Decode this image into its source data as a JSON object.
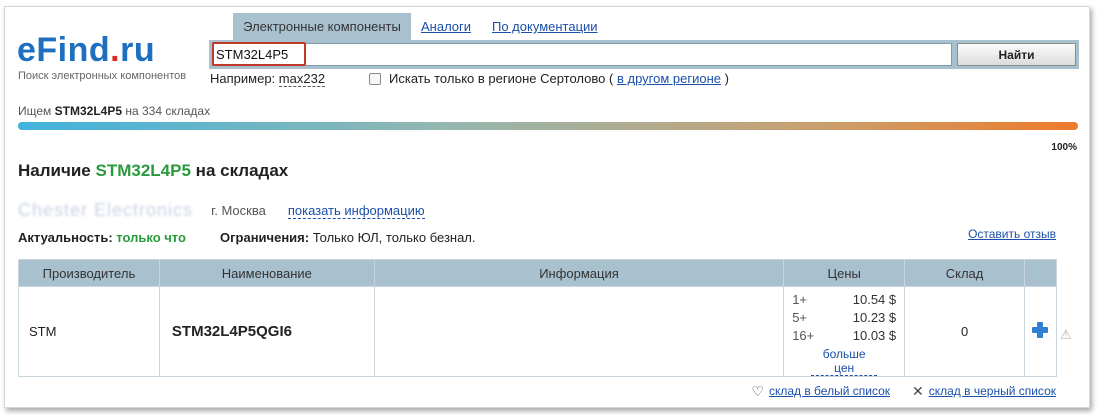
{
  "header": {
    "logo": {
      "part1": "eFind",
      "part2": ".",
      "part3": "ru"
    },
    "tagline": "Поиск электронных компонентов",
    "tabs": [
      {
        "label": "Электронные компоненты",
        "active": true
      },
      {
        "label": "Аналоги",
        "active": false
      },
      {
        "label": "По документации",
        "active": false
      }
    ],
    "search": {
      "value": "STM32L4P5",
      "button_label": "Найти"
    },
    "example": {
      "prefix": "Например:",
      "value": "max232"
    },
    "region": {
      "checkbox_label": "Искать только в регионе Сертолово",
      "open_paren": "(",
      "other_region_link": "в другом регионе",
      "close_paren": ")"
    }
  },
  "progress": {
    "prefix": "Ищем",
    "query": "STM32L4P5",
    "suffix": "на 334 складах",
    "percent_label": "100%",
    "value": 100
  },
  "availability": {
    "title_prefix": "Наличие",
    "part": "STM32L4P5",
    "title_suffix": "на складах",
    "seller_name": "Chester Electronics",
    "city": "г. Москва",
    "show_info_link": "показать информацию",
    "actuality_label": "Актуальность:",
    "actuality_value": "только что",
    "restrictions_label": "Ограничения:",
    "restrictions_value": "Только ЮЛ, только безнал.",
    "leave_review": "Оставить отзыв"
  },
  "table": {
    "headers": [
      "Производитель",
      "Наименование",
      "Информация",
      "Цены",
      "Склад",
      ""
    ],
    "rows": [
      {
        "manufacturer": "STM",
        "name": "STM32L4P5QGI6",
        "info": "",
        "prices": [
          {
            "qty": "1+",
            "price": "10.54 $"
          },
          {
            "qty": "5+",
            "price": "10.23 $"
          },
          {
            "qty": "16+",
            "price": "10.03 $"
          }
        ],
        "more_prices": "больше цен",
        "stock": "0"
      }
    ]
  },
  "footer": {
    "whitelist": "склад в белый список",
    "blacklist": "склад в черный список"
  },
  "colors": {
    "accent": "#a9c1cf",
    "link": "#1b4fa8",
    "green": "#2a9a3c",
    "logo_blue": "#1f6fc0",
    "logo_red": "#d82a26"
  },
  "icons": [
    "checkbox-icon",
    "plus-icon",
    "warning-icon",
    "heart-icon",
    "close-icon"
  ]
}
